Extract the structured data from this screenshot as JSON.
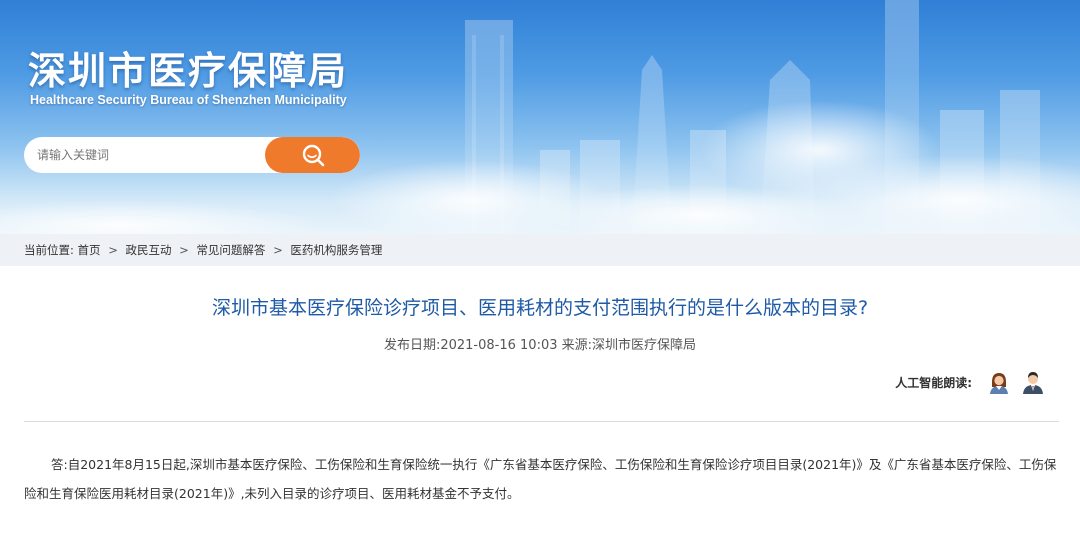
{
  "header": {
    "site_title": "深圳市医疗保障局",
    "site_subtitle": "Healthcare Security Bureau of Shenzhen Municipality",
    "search": {
      "placeholder": "请输入关键词",
      "button_icon": "search-icon"
    },
    "colors": {
      "banner_blue": "#3a86d8",
      "search_orange": "#f07a2c"
    }
  },
  "breadcrumb": {
    "prefix": "当前位置:",
    "items": [
      "首页",
      "政民互动",
      "常见问题解答",
      "医药机构服务管理"
    ],
    "separator": ">"
  },
  "article": {
    "title": "深圳市基本医疗保险诊疗项目、医用耗材的支付范围执行的是什么版本的目录?",
    "meta": "发布日期:2021-08-16 10:03 来源:深圳市医疗保障局",
    "tts": {
      "label": "人工智能朗读:",
      "voices": [
        "female-voice-icon",
        "male-voice-icon"
      ]
    },
    "body": "答:自2021年8月15日起,深圳市基本医疗保险、工伤保险和生育保险统一执行《广东省基本医疗保险、工伤保险和生育保险诊疗项目目录(2021年)》及《广东省基本医疗保险、工伤保险和生育保险医用耗材目录(2021年)》,未列入目录的诊疗项目、医用耗材基金不予支付。",
    "title_color": "#1f5aa6"
  }
}
